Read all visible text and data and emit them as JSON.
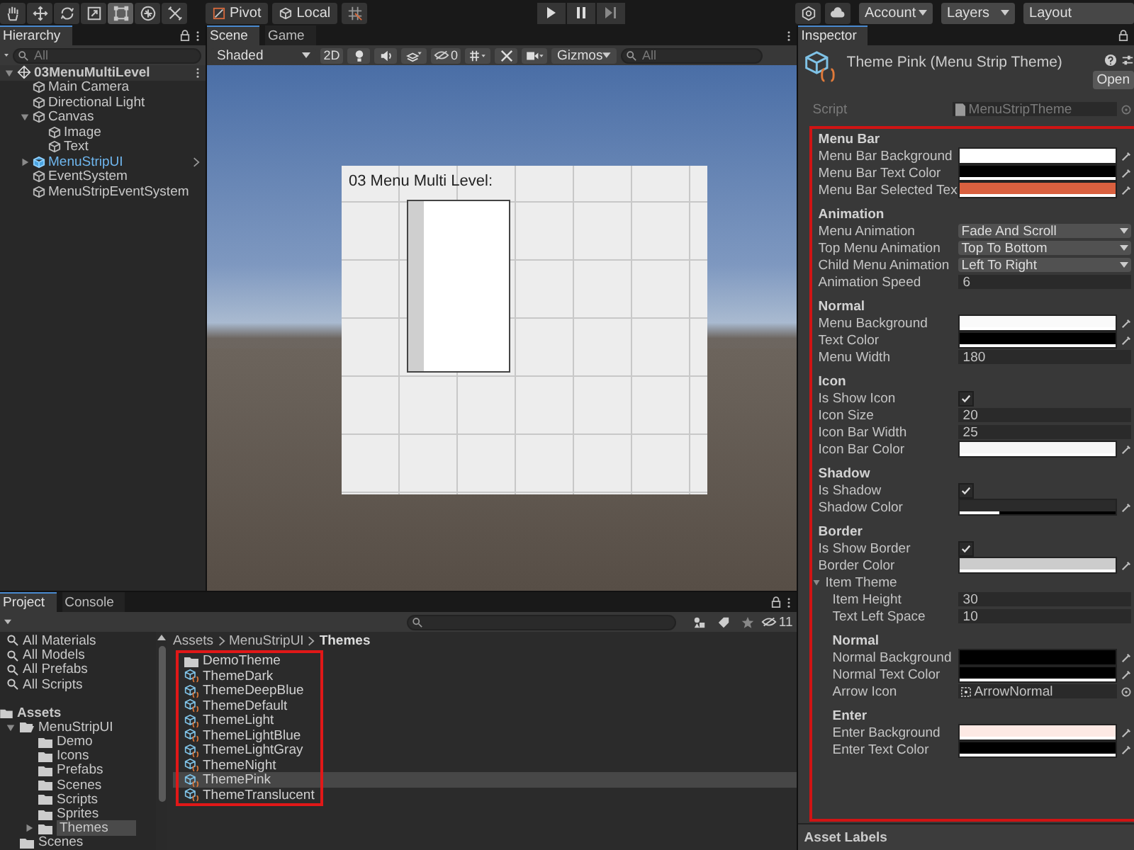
{
  "toolbar": {
    "tools": [
      {
        "kind": "hand",
        "selected": false
      },
      {
        "kind": "move",
        "selected": false
      },
      {
        "kind": "rotate",
        "selected": false
      },
      {
        "kind": "scale",
        "selected": false
      },
      {
        "kind": "rect",
        "selected": true
      },
      {
        "kind": "transform",
        "selected": false
      },
      {
        "kind": "custom",
        "selected": false
      }
    ],
    "pivot": "Pivot",
    "local": "Local",
    "account": "Account",
    "layers": "Layers",
    "layout": "Layout"
  },
  "hierarchy": {
    "title": "Hierarchy",
    "search": {
      "placeholder": "All"
    },
    "scene": {
      "label": "03MenuMultiLevel",
      "selected": false,
      "expanded": true,
      "children": [
        {
          "label": "Main Camera",
          "selected": false
        },
        {
          "label": "Directional Light",
          "selected": false
        },
        {
          "label": "Canvas",
          "selected": false,
          "expanded": true,
          "children": [
            {
              "label": "Image",
              "selected": false
            },
            {
              "label": "Text",
              "selected": false
            }
          ]
        },
        {
          "label": "MenuStripUI",
          "selected": true,
          "expanded": false
        },
        {
          "label": "EventSystem",
          "selected": false
        },
        {
          "label": "MenuStripEventSystem",
          "selected": false
        }
      ]
    }
  },
  "scene": {
    "tabs": [
      {
        "label": "Scene",
        "selected": true
      },
      {
        "label": "Game",
        "selected": false
      }
    ],
    "shading": "Shaded",
    "mode_2d": "2D",
    "hidden_count": "0",
    "gizmos": "Gizmos",
    "search": {
      "placeholder": "All"
    },
    "canvas_title": "03 Menu Multi Level:"
  },
  "inspector": {
    "tab": "Inspector",
    "asset_title": "Theme Pink (Menu Strip Theme)",
    "open_button": "Open",
    "script": {
      "label": "Script",
      "value": "MenuStripTheme",
      "disabled": true
    },
    "properties": [
      {
        "kind": "header",
        "label": "Menu Bar"
      },
      {
        "kind": "color",
        "label": "Menu Bar Background",
        "color": "#ffffff",
        "level": 1
      },
      {
        "kind": "color",
        "label": "Menu Bar Text Color",
        "color": "#000000",
        "level": 1
      },
      {
        "kind": "color",
        "label": "Menu Bar Selected Tex",
        "color": "#d9603f",
        "level": 1
      },
      {
        "kind": "header",
        "label": "Animation"
      },
      {
        "kind": "dropdown",
        "label": "Menu Animation",
        "value": "Fade And Scroll"
      },
      {
        "kind": "dropdown",
        "label": "Top Menu Animation",
        "value": "Top To Bottom"
      },
      {
        "kind": "dropdown",
        "label": "Child Menu Animation",
        "value": "Left To Right"
      },
      {
        "kind": "number",
        "label": "Animation Speed",
        "value": "6"
      },
      {
        "kind": "header",
        "label": "Normal"
      },
      {
        "kind": "color",
        "label": "Menu Background",
        "color": "#fafafa",
        "level": 1
      },
      {
        "kind": "color",
        "label": "Text Color",
        "color": "#000000",
        "level": 1
      },
      {
        "kind": "number",
        "label": "Menu Width",
        "value": "180"
      },
      {
        "kind": "header",
        "label": "Icon"
      },
      {
        "kind": "checkbox",
        "label": "Is Show Icon",
        "checked": true
      },
      {
        "kind": "number",
        "label": "Icon Size",
        "value": "20"
      },
      {
        "kind": "number",
        "label": "Icon Bar Width",
        "value": "25"
      },
      {
        "kind": "color",
        "label": "Icon Bar Color",
        "color": "#f7f7f7",
        "level": 1
      },
      {
        "kind": "header",
        "label": "Shadow"
      },
      {
        "kind": "checkbox",
        "label": "Is Shadow",
        "checked": true
      },
      {
        "kind": "color",
        "label": "Shadow Color",
        "color": "#2b2b2b",
        "level": 0.25
      },
      {
        "kind": "header",
        "label": "Border"
      },
      {
        "kind": "checkbox",
        "label": "Is Show Border",
        "checked": true
      },
      {
        "kind": "color",
        "label": "Border Color",
        "color": "#cccccc",
        "level": 1
      },
      {
        "kind": "foldout",
        "label": "Item Theme",
        "expanded": true,
        "children": [
          {
            "kind": "number",
            "label": "Item Height",
            "value": "30"
          },
          {
            "kind": "number",
            "label": "Text Left Space",
            "value": "10"
          },
          {
            "kind": "header",
            "label": "Normal"
          },
          {
            "kind": "color",
            "label": "Normal Background",
            "color": "#000000"
          },
          {
            "kind": "color",
            "label": "Normal Text Color",
            "color": "#000000",
            "level": 1
          },
          {
            "kind": "object",
            "label": "Arrow Icon",
            "value": "ArrowNormal"
          },
          {
            "kind": "header",
            "label": "Enter"
          },
          {
            "kind": "color",
            "label": "Enter Background",
            "color": "#fde9e4",
            "level": 1
          },
          {
            "kind": "color",
            "label": "Enter Text Color",
            "color": "#000000",
            "level": 1
          }
        ]
      }
    ],
    "asset_labels": "Asset Labels"
  },
  "project": {
    "tabs": [
      {
        "label": "Project",
        "selected": true
      },
      {
        "label": "Console",
        "selected": false
      }
    ],
    "hidden_count": "11",
    "favorites": [
      "All Materials",
      "All Models",
      "All Prefabs",
      "All Scripts"
    ],
    "assets": {
      "label": "Assets",
      "children": [
        {
          "label": "MenuStripUI",
          "selected": false,
          "expanded": true,
          "children": [
            {
              "label": "Demo",
              "selected": false
            },
            {
              "label": "Icons",
              "selected": false
            },
            {
              "label": "Prefabs",
              "selected": false
            },
            {
              "label": "Scenes",
              "selected": false
            },
            {
              "label": "Scripts",
              "selected": false
            },
            {
              "label": "Sprites",
              "selected": false
            },
            {
              "label": "Themes",
              "selected": true,
              "expanded": false
            }
          ]
        },
        {
          "label": "Scenes",
          "selected": false
        }
      ]
    },
    "breadcrumb": [
      "Assets",
      "MenuStripUI",
      "Themes"
    ],
    "files": [
      {
        "kind": "folder",
        "label": "DemoTheme",
        "selected": false
      },
      {
        "kind": "theme",
        "label": "ThemeDark",
        "selected": false
      },
      {
        "kind": "theme",
        "label": "ThemeDeepBlue",
        "selected": false
      },
      {
        "kind": "theme",
        "label": "ThemeDefault",
        "selected": false
      },
      {
        "kind": "theme",
        "label": "ThemeLight",
        "selected": false
      },
      {
        "kind": "theme",
        "label": "ThemeLightBlue",
        "selected": false
      },
      {
        "kind": "theme",
        "label": "ThemeLightGray",
        "selected": false
      },
      {
        "kind": "theme",
        "label": "ThemeNight",
        "selected": false
      },
      {
        "kind": "theme",
        "label": "ThemePink",
        "selected": true
      },
      {
        "kind": "theme",
        "label": "ThemeTranslucent",
        "selected": false
      }
    ]
  }
}
